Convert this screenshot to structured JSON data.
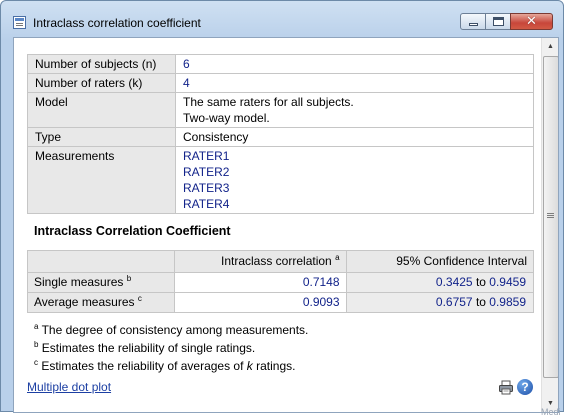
{
  "window": {
    "title": "Intraclass correlation coefficient",
    "controls": {
      "minimize": "minimize",
      "maximize": "maximize",
      "close": "✕"
    }
  },
  "info": {
    "subjects_label": "Number of subjects (n)",
    "subjects_value": "6",
    "raters_label": "Number of raters (k)",
    "raters_value": "4",
    "model_label": "Model",
    "model_lines": [
      "The same raters for all subjects.",
      "Two-way model."
    ],
    "type_label": "Type",
    "type_value": "Consistency",
    "measurements_label": "Measurements",
    "measurements": [
      "RATER1",
      "RATER2",
      "RATER3",
      "RATER4"
    ]
  },
  "icc": {
    "heading": "Intraclass Correlation Coefficient",
    "col_icc": "Intraclass correlation",
    "col_icc_sup": "a",
    "col_ci": "95% Confidence Interval",
    "rows": [
      {
        "label": "Single measures",
        "sup": "b",
        "value": "0.7148",
        "ci_low": "0.3425",
        "ci_to": "to",
        "ci_high": "0.9459"
      },
      {
        "label": "Average measures",
        "sup": "c",
        "value": "0.9093",
        "ci_low": "0.6757",
        "ci_to": "to",
        "ci_high": "0.9859"
      }
    ]
  },
  "notes": [
    {
      "sup": "a",
      "text": "The degree of consistency among measurements."
    },
    {
      "sup": "b",
      "text": "Estimates the reliability of single ratings."
    },
    {
      "sup": "c",
      "text_pre": "Estimates the reliability of averages of ",
      "text_italic": "k",
      "text_post": " ratings."
    }
  ],
  "footer": {
    "link": "Multiple dot plot",
    "help": "?"
  },
  "icons": {
    "print": "print-icon",
    "help": "help-icon",
    "app": "table-icon"
  },
  "corner_text": "Medi",
  "colors": {
    "accent_text": "#12238a",
    "link": "#1c3fa3",
    "header_bg": "#e8e8e8"
  }
}
